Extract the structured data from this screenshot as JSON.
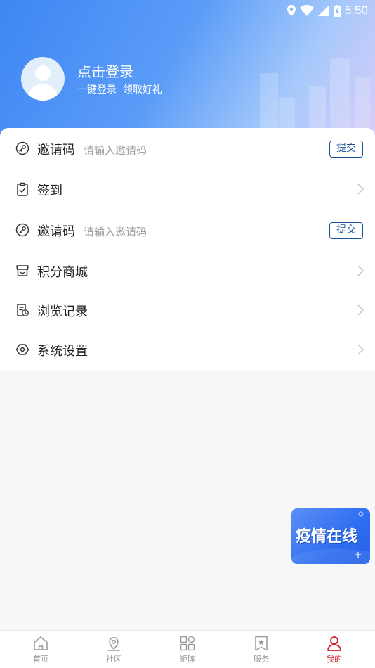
{
  "status_bar": {
    "time": "5:50"
  },
  "profile": {
    "title": "点击登录",
    "subtitle": "一键登录  领取好礼"
  },
  "menu": [
    {
      "icon": "key-icon",
      "label": "邀请码",
      "placeholder": "请输入邀请码",
      "button": "提交"
    },
    {
      "icon": "clipboard-check-icon",
      "label": "签到"
    },
    {
      "icon": "key-icon",
      "label": "邀请码",
      "placeholder": "请输入邀请码",
      "button": "提交"
    },
    {
      "icon": "store-icon",
      "label": "积分商城"
    },
    {
      "icon": "history-icon",
      "label": "浏览记录"
    },
    {
      "icon": "settings-hexagon-icon",
      "label": "系统设置"
    }
  ],
  "floating_banner": {
    "text": "疫情在线"
  },
  "tabbar": {
    "active_color": "#d01e2a",
    "inactive_color": "#999999",
    "items": [
      {
        "label": "首页",
        "icon": "home-icon"
      },
      {
        "label": "社区",
        "icon": "location-icon"
      },
      {
        "label": "矩阵",
        "icon": "grid-icon"
      },
      {
        "label": "服务",
        "icon": "star-bookmark-icon"
      },
      {
        "label": "我的",
        "icon": "user-icon",
        "active": true
      }
    ]
  }
}
